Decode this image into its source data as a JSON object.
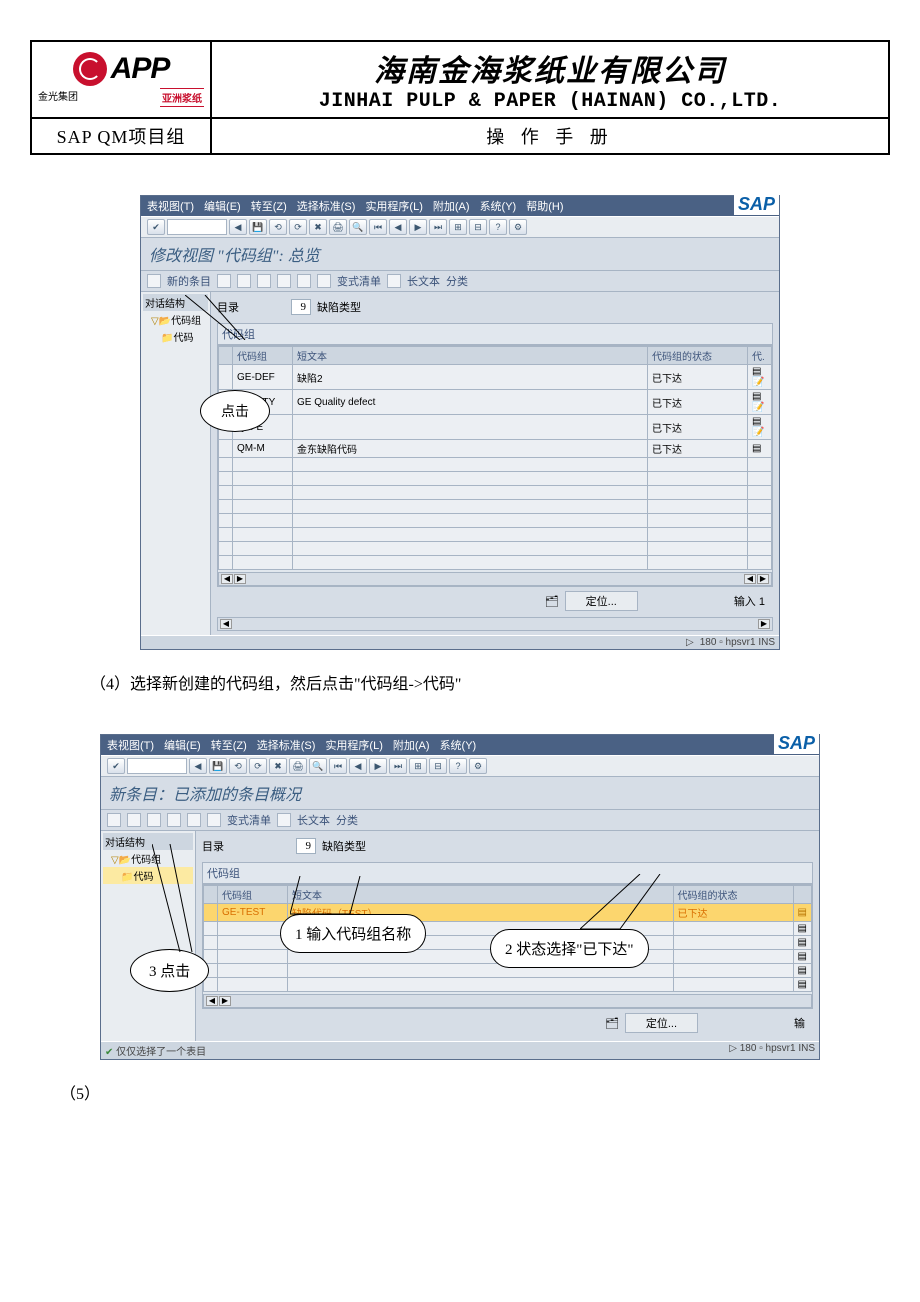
{
  "header": {
    "logo_app": "APP",
    "logo_sub_l": "金光集团",
    "logo_sub_r": "亚洲浆纸",
    "company_cn": "海南金海浆纸业有限公司",
    "company_en": "JINHAI PULP & PAPER (HAINAN) CO.,LTD.",
    "sap_group": "SAP QM项目组",
    "manual": "操 作 手 册"
  },
  "shot1": {
    "menus": [
      "表视图(T)",
      "编辑(E)",
      "转至(Z)",
      "选择标准(S)",
      "实用程序(L)",
      "附加(A)",
      "系统(Y)",
      "帮助(H)"
    ],
    "sap_logo": "SAP",
    "title": "修改视图 \"代码组\": 总览",
    "subtool_new": "新的条目",
    "subtool_var": "变式清单",
    "subtool_long": "长文本",
    "subtool_cat": "分类",
    "tree_hdr": "对话结构",
    "tree_l1": "代码组",
    "tree_l2": "代码",
    "catalog_lbl": "目录",
    "catalog_val": "9",
    "catalog_txt": "缺陷类型",
    "grid_title": "代码组",
    "columns": [
      "代码组",
      "短文本",
      "代码组的状态",
      "代."
    ],
    "rows": [
      {
        "code": "GE-DEF",
        "text": "缺陷2",
        "status": "已下达"
      },
      {
        "code": "GE-QTY",
        "text": "GE Quality defect",
        "status": "已下达"
      },
      {
        "code": "QM-E",
        "text": "",
        "status": "已下达"
      },
      {
        "code": "QM-M",
        "text": "金东缺陷代码",
        "status": "已下达"
      }
    ],
    "locate_btn": "定位...",
    "input_lbl": "输入 1",
    "status_right": "180 ▫ hpsvr1  INS",
    "callout": "点击"
  },
  "instr4": "（4）选择新创建的代码组，然后点击\"代码组->代码\"",
  "shot2": {
    "menus": [
      "表视图(T)",
      "编辑(E)",
      "转至(Z)",
      "选择标准(S)",
      "实用程序(L)",
      "附加(A)",
      "系统(Y)"
    ],
    "sap_logo": "SAP",
    "title": "新条目：已添加的条目概况",
    "subtool_var": "变式清单",
    "subtool_long": "长文本",
    "subtool_cat": "分类",
    "tree_hdr": "对话结构",
    "tree_l1": "代码组",
    "tree_l2": "代码",
    "catalog_lbl": "目录",
    "catalog_val": "9",
    "catalog_txt": "缺陷类型",
    "grid_title": "代码组",
    "columns": [
      "代码组",
      "短文本",
      "代码组的状态"
    ],
    "row_code": "GE-TEST",
    "row_text": "缺陷代码（TEST）",
    "row_status": "已下达",
    "locate_btn": "定位...",
    "input_lbl": "输",
    "status_left": "仅仅选择了一个表目",
    "status_right": "180 ▫ hpsvr1  INS",
    "call1": "1 输入代码组名称",
    "call2": "2 状态选择\"已下达\"",
    "call3": "3 点击"
  },
  "instr5": "（5）"
}
